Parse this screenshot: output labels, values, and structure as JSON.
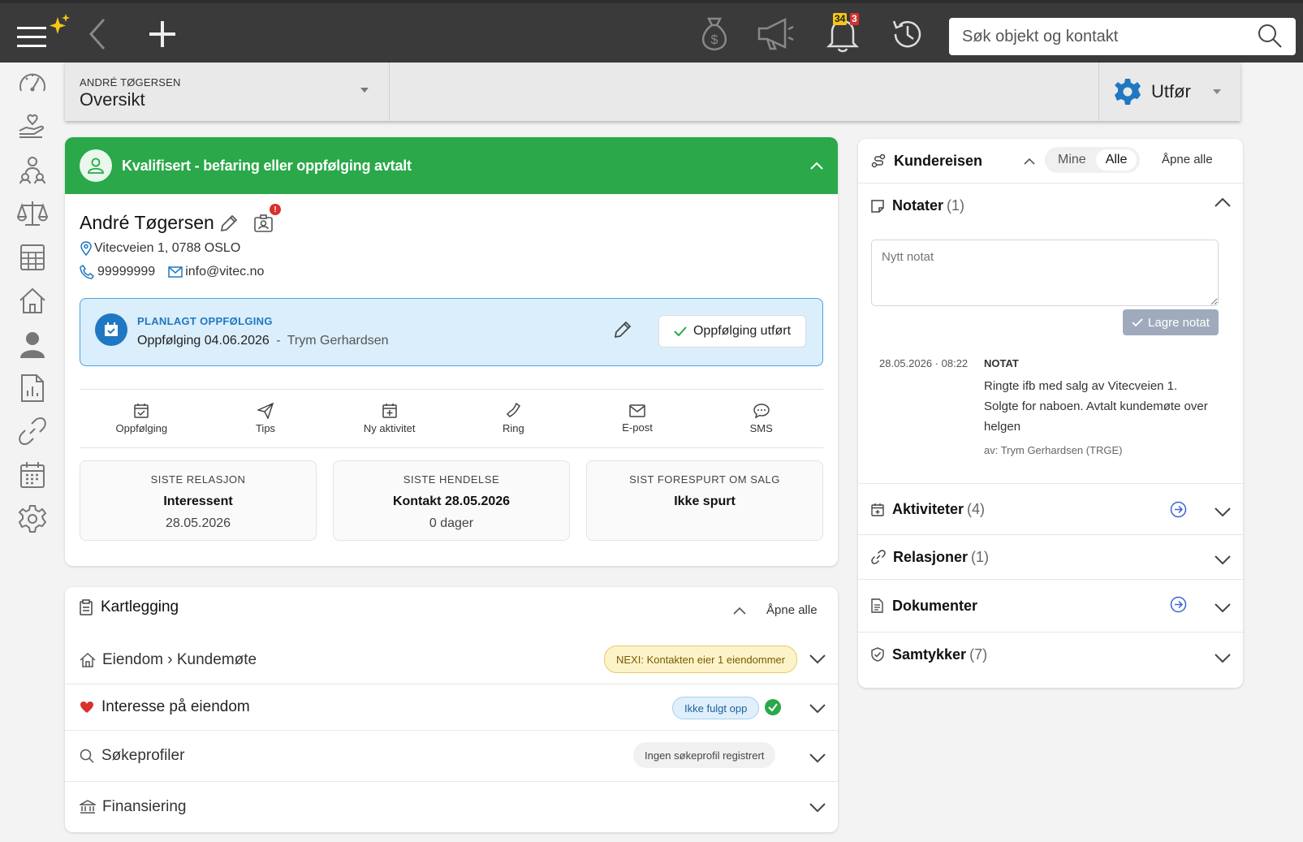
{
  "topbar": {
    "notifications_count": "34",
    "notifications_alert": "3",
    "search_placeholder": "Søk objekt og kontakt"
  },
  "sidebar": {
    "items": [
      "dashboard",
      "deals",
      "teams",
      "legal",
      "calculator",
      "properties",
      "contacts",
      "reports",
      "links",
      "calendar",
      "settings"
    ]
  },
  "subheader": {
    "context_name": "ANDRÉ TØGERSEN",
    "page_title": "Oversikt",
    "action_label": "Utfør"
  },
  "contact": {
    "status": "Kvalifisert - befaring eller oppfølging avtalt",
    "name": "André Tøgersen",
    "address": "Vitecveien 1, 0788 OSLO",
    "phone": "99999999",
    "email": "info@vitec.no",
    "followup": {
      "title": "PLANLAGT OPPFØLGING",
      "text": "Oppfølging 04.06.2026",
      "separator": "-",
      "by": "Trym Gerhardsen",
      "done_label": "Oppfølging utført"
    },
    "actions": [
      "Oppfølging",
      "Tips",
      "Ny aktivitet",
      "Ring",
      "E-post",
      "SMS"
    ],
    "stats": [
      {
        "header": "SISTE RELASJON",
        "value": "Interessent",
        "sub": "28.05.2026"
      },
      {
        "header": "SISTE HENDELSE",
        "value": "Kontakt 28.05.2026",
        "sub": "0 dager"
      },
      {
        "header": "SIST FORESPURT OM SALG",
        "value": "Ikke spurt",
        "sub": ""
      }
    ]
  },
  "kartlegging": {
    "title": "Kartlegging",
    "open_all": "Åpne alle",
    "rows": [
      {
        "label": "Eiendom › Kundemøte",
        "tag": "NEXI: Kontakten eier 1 eiendommer"
      },
      {
        "label": "Interesse på eiendom",
        "tag": "Ikke fulgt opp"
      },
      {
        "label": "Søkeprofiler",
        "tag": "Ingen søkeprofil registrert"
      },
      {
        "label": "Finansiering",
        "tag": ""
      }
    ]
  },
  "kundereisen": {
    "title": "Kundereisen",
    "seg_mine": "Mine",
    "seg_alle": "Alle",
    "open_all": "Åpne alle",
    "notes": {
      "title": "Notater",
      "count": "(1)",
      "placeholder": "Nytt notat",
      "save_label": "Lagre notat",
      "entry": {
        "date": "28.05.2026 · 08:22",
        "type": "NOTAT",
        "text": "Ringte ifb med salg av Vitecveien 1. Solgte for naboen. Avtalt kundemøte over helgen",
        "author": "av: Trym Gerhardsen (TRGE)"
      }
    },
    "sections": [
      {
        "title": "Aktiviteter",
        "count": "(4)"
      },
      {
        "title": "Relasjoner",
        "count": "(1)"
      },
      {
        "title": "Dokumenter",
        "count": ""
      },
      {
        "title": "Samtykker",
        "count": "(7)"
      }
    ]
  },
  "colors": {
    "status_green": "#2aa84a",
    "accent_blue": "#1f78c1",
    "topbar": "#3a3a3a"
  }
}
